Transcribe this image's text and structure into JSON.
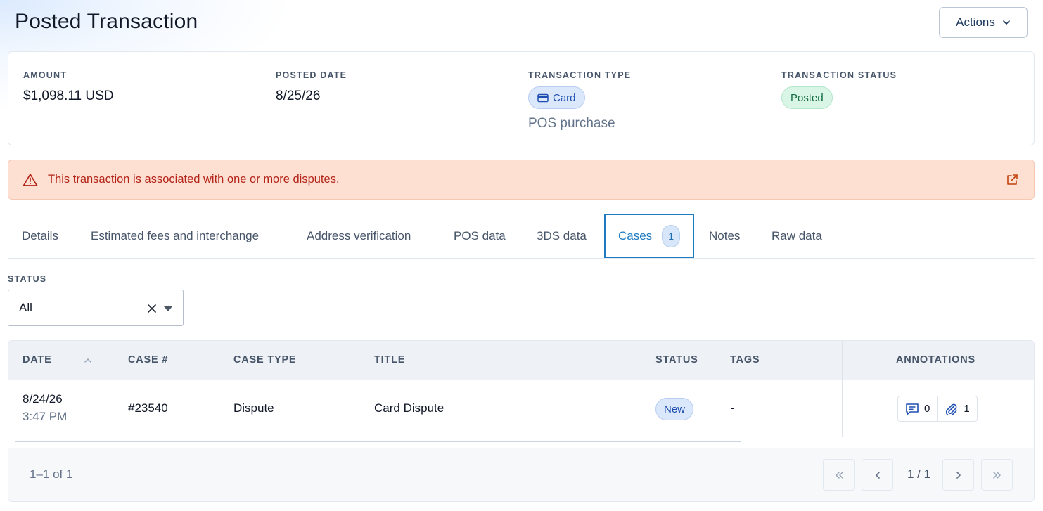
{
  "header": {
    "title": "Posted Transaction",
    "actions_label": "Actions"
  },
  "summary": {
    "amount": {
      "label": "AMOUNT",
      "value": "$1,098.11 USD"
    },
    "posted_date": {
      "label": "POSTED DATE",
      "value": "8/25/26"
    },
    "transaction_type": {
      "label": "TRANSACTION TYPE",
      "pill": "Card",
      "subtext": "POS purchase"
    },
    "transaction_status": {
      "label": "TRANSACTION STATUS",
      "pill": "Posted"
    }
  },
  "alert": {
    "text": "This transaction is associated with one or more disputes."
  },
  "tabs": [
    {
      "label": "Details"
    },
    {
      "label": "Estimated fees and interchange"
    },
    {
      "label": "Address verification"
    },
    {
      "label": "POS data"
    },
    {
      "label": "3DS data"
    },
    {
      "label": "Cases",
      "badge": "1",
      "active": true
    },
    {
      "label": "Notes"
    },
    {
      "label": "Raw data"
    }
  ],
  "filter": {
    "label": "STATUS",
    "value": "All"
  },
  "table": {
    "columns": {
      "date": "DATE",
      "case_no": "CASE #",
      "case_type": "CASE TYPE",
      "title": "TITLE",
      "status": "STATUS",
      "tags": "TAGS",
      "annotations": "ANNOTATIONS"
    },
    "rows": [
      {
        "date": "8/24/26",
        "time": "3:47 PM",
        "case_no": "#23540",
        "case_type": "Dispute",
        "title": "Card Dispute",
        "status": "New",
        "tags": "-",
        "comments": "0",
        "attachments": "1"
      }
    ]
  },
  "pagination": {
    "range": "1–1 of 1",
    "page": "1 / 1"
  },
  "colors": {
    "accent": "#1f7bc1",
    "alert_bg": "#fde0d2",
    "alert_text": "#b42318",
    "status_posted": "#146c43",
    "pill_blue": "#1e4fb0"
  },
  "icons": {
    "actions": "chevron-down-icon",
    "card": "credit-card-icon",
    "alert": "warning-triangle-icon",
    "alert_link": "external-link-icon",
    "filter_clear": "close-icon",
    "filter_open": "caret-down-icon",
    "sort": "sort-up-icon",
    "comments": "comment-icon",
    "attachments": "paperclip-icon",
    "first_page": "double-chevron-left-icon",
    "prev_page": "chevron-left-icon",
    "next_page": "chevron-right-icon",
    "last_page": "double-chevron-right-icon"
  }
}
